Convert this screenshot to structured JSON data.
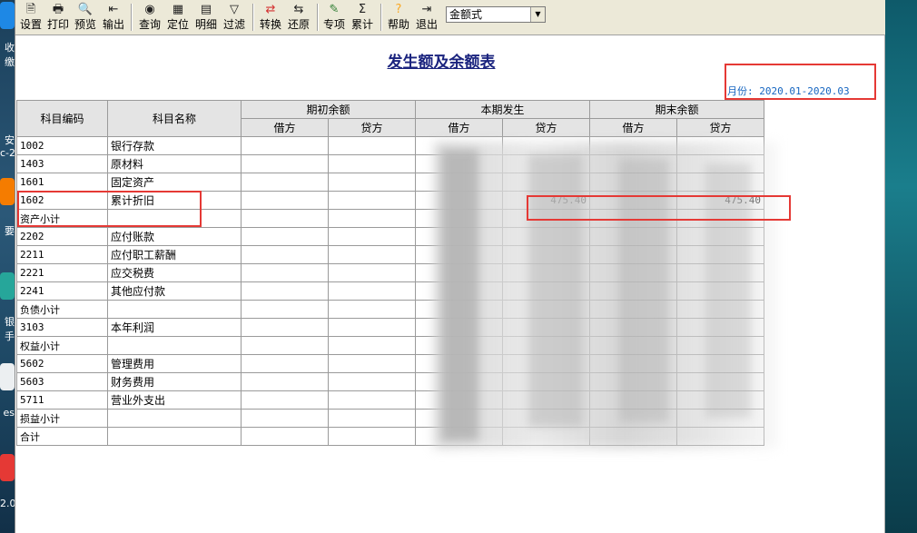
{
  "desktop": {
    "left_labels": [
      "收",
      "缴",
      "安",
      "c-2",
      "要",
      "银",
      "手",
      "es",
      "2.0"
    ]
  },
  "toolbar": {
    "buttons": [
      {
        "label": "设置",
        "icon": "settings-doc-icon"
      },
      {
        "label": "打印",
        "icon": "printer-icon"
      },
      {
        "label": "预览",
        "icon": "preview-icon"
      },
      {
        "label": "输出",
        "icon": "export-icon"
      },
      {
        "label": "查询",
        "icon": "binoculars-icon"
      },
      {
        "label": "定位",
        "icon": "locate-icon"
      },
      {
        "label": "明细",
        "icon": "detail-icon"
      },
      {
        "label": "过滤",
        "icon": "filter-icon"
      },
      {
        "label": "转换",
        "icon": "convert-icon"
      },
      {
        "label": "还原",
        "icon": "restore-icon"
      },
      {
        "label": "专项",
        "icon": "special-icon"
      },
      {
        "label": "累计",
        "icon": "sigma-icon"
      },
      {
        "label": "帮助",
        "icon": "help-icon"
      },
      {
        "label": "退出",
        "icon": "exit-icon"
      }
    ],
    "mode_select": "金额式"
  },
  "report": {
    "title": "发生额及余额表",
    "period_label": "月份: 2020.01-2020.03"
  },
  "table": {
    "headers": {
      "code": "科目编码",
      "name": "科目名称",
      "opening": "期初余额",
      "current": "本期发生",
      "closing": "期末余额",
      "debit": "借方",
      "credit": "贷方"
    },
    "rows": [
      {
        "code": "1002",
        "name": "银行存款",
        "cur_credit": "",
        "end_credit": ""
      },
      {
        "code": "1403",
        "name": "原材料",
        "cur_credit": "",
        "end_credit": ""
      },
      {
        "code": "1601",
        "name": "固定资产",
        "cur_credit": "",
        "end_credit": ""
      },
      {
        "code": "1602",
        "name": "累计折旧",
        "cur_credit": "475.40",
        "end_credit": "475.40"
      },
      {
        "code": "资产小计",
        "name": "",
        "cur_credit": "",
        "end_credit": ""
      },
      {
        "code": "2202",
        "name": "应付账款",
        "cur_credit": "",
        "end_credit": ""
      },
      {
        "code": "2211",
        "name": "应付职工薪酬",
        "cur_credit": "",
        "end_credit": ""
      },
      {
        "code": "2221",
        "name": "应交税费",
        "cur_credit": "",
        "end_credit": ""
      },
      {
        "code": "2241",
        "name": "其他应付款",
        "cur_credit": "",
        "end_credit": ""
      },
      {
        "code": "负债小计",
        "name": "",
        "cur_credit": "",
        "end_credit": ""
      },
      {
        "code": "3103",
        "name": "本年利润",
        "cur_credit": "",
        "end_credit": ""
      },
      {
        "code": "权益小计",
        "name": "",
        "cur_credit": "",
        "end_credit": ""
      },
      {
        "code": "5602",
        "name": "管理费用",
        "cur_credit": "",
        "end_credit": ""
      },
      {
        "code": "5603",
        "name": "财务费用",
        "cur_credit": "",
        "end_credit": ""
      },
      {
        "code": "5711",
        "name": "营业外支出",
        "cur_credit": "",
        "end_credit": ""
      },
      {
        "code": "损益小计",
        "name": "",
        "cur_credit": "",
        "end_credit": ""
      },
      {
        "code": "合计",
        "name": "",
        "cur_credit": "",
        "end_credit": ""
      }
    ]
  },
  "colors": {
    "title": "#1a237e",
    "period": "#1565c0",
    "highlight": "#e53935",
    "toolbar_bg": "#ece9d8"
  }
}
